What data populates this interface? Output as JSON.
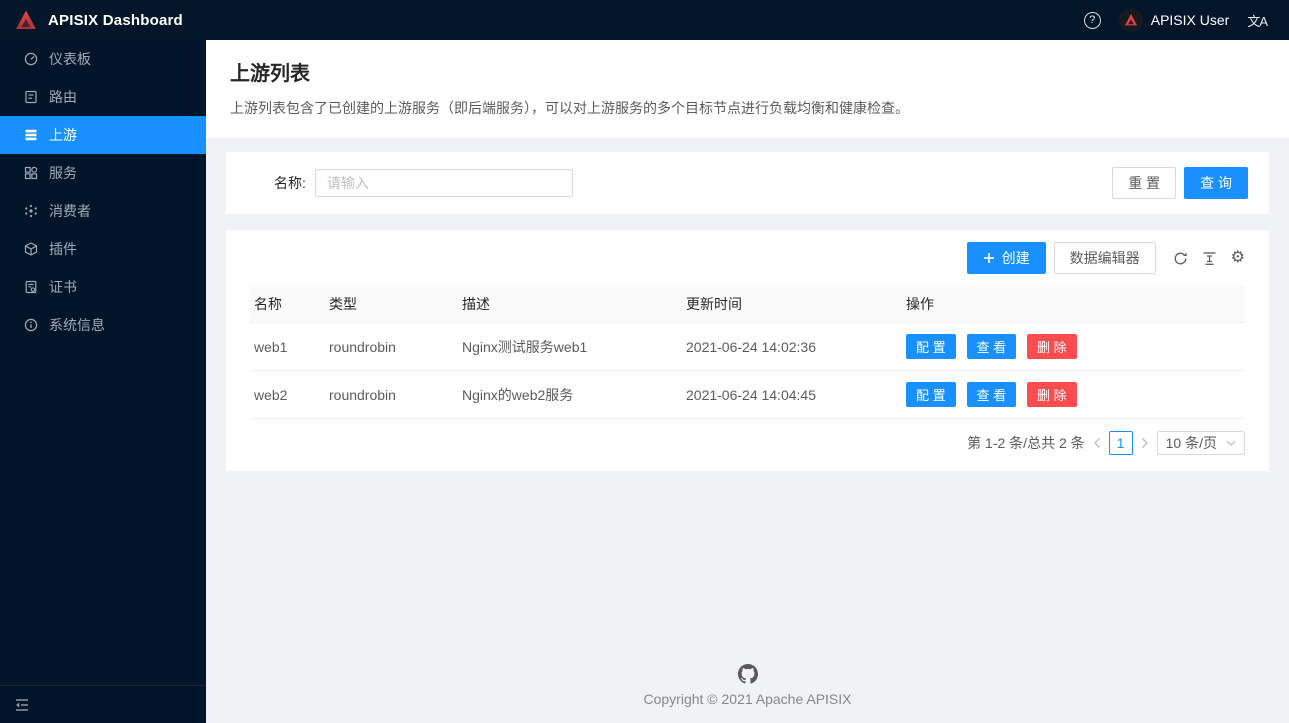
{
  "header": {
    "title": "APISIX Dashboard",
    "user": "APISIX User"
  },
  "icons": {
    "help": "?",
    "translate": "文A",
    "settings": "⚙"
  },
  "sidebar": {
    "items": [
      {
        "label": "仪表板",
        "icon": "dashboard-icon",
        "active": false
      },
      {
        "label": "路由",
        "icon": "route-icon",
        "active": false
      },
      {
        "label": "上游",
        "icon": "upstream-icon",
        "active": true
      },
      {
        "label": "服务",
        "icon": "service-icon",
        "active": false
      },
      {
        "label": "消费者",
        "icon": "consumer-icon",
        "active": false
      },
      {
        "label": "插件",
        "icon": "plugin-icon",
        "active": false
      },
      {
        "label": "证书",
        "icon": "certificate-icon",
        "active": false
      },
      {
        "label": "系统信息",
        "icon": "system-info-icon",
        "active": false
      }
    ]
  },
  "page": {
    "title": "上游列表",
    "description": "上游列表包含了已创建的上游服务（即后端服务），可以对上游服务的多个目标节点进行负载均衡和健康检查。"
  },
  "search": {
    "name_label": "名称:",
    "placeholder": "请输入",
    "reset_label": "重 置",
    "query_label": "查 询"
  },
  "toolbar": {
    "create_label": "创建",
    "editor_label": "数据编辑器"
  },
  "table": {
    "columns": [
      "名称",
      "类型",
      "描述",
      "更新时间",
      "操作"
    ],
    "rows": [
      {
        "name": "web1",
        "type": "roundrobin",
        "desc": "Nginx测试服务web1",
        "updated": "2021-06-24 14:02:36"
      },
      {
        "name": "web2",
        "type": "roundrobin",
        "desc": "Nginx的web2服务",
        "updated": "2021-06-24 14:04:45"
      }
    ],
    "actions": {
      "configure": "配 置",
      "view": "查 看",
      "delete": "删 除"
    }
  },
  "pagination": {
    "total_text": "第 1-2 条/总共 2 条",
    "current_page": "1",
    "page_size": "10 条/页"
  },
  "footer": {
    "copyright": "Copyright © 2021 Apache APISIX"
  },
  "colors": {
    "primary": "#1890ff",
    "danger": "#ff4d4f",
    "sider_bg": "#001529",
    "content_bg": "#f0f2f5"
  }
}
